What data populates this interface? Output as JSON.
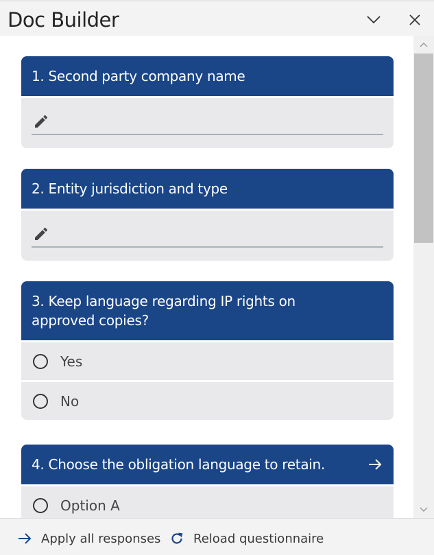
{
  "app": {
    "title": "Doc Builder"
  },
  "window_controls": {
    "collapse_icon": "chevron-down-icon",
    "close_icon": "close-icon"
  },
  "questions": [
    {
      "label": "1. Second party company name",
      "type": "text",
      "value": ""
    },
    {
      "label": "2. Entity jurisdiction and type",
      "type": "text",
      "value": ""
    },
    {
      "label_line1": "3. Keep language regarding IP rights on",
      "label_line2": "approved copies?",
      "type": "radio",
      "options": [
        "Yes",
        "No"
      ]
    },
    {
      "label": "4. Choose the obligation language to retain.",
      "type": "radio",
      "options": [
        "Option A"
      ],
      "has_arrow": true
    }
  ],
  "footer": {
    "apply_label": "Apply all responses",
    "reload_label": "Reload questionnaire"
  },
  "colors": {
    "header_bg": "#1a4587",
    "card_bg": "#e9e9ec",
    "accent": "#1a4587"
  }
}
